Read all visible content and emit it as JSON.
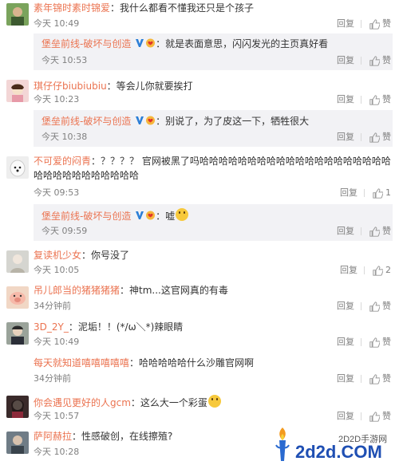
{
  "comments": [
    {
      "user": "素年锦时素时锦爱",
      "text": "：我什么都看不懂我还只是个孩子",
      "time": "今天 10:49",
      "reply": "回复",
      "like": "赞"
    },
    {
      "sub": true,
      "user": "堡垒前线-破坏与创造",
      "text": "：就是表面意思，闪闪发光的主页真好看",
      "time": "今天 10:53",
      "reply": "回复",
      "like": "赞"
    },
    {
      "user": "琪仔仔biubiubiu",
      "text": "：等会儿你就要挨打",
      "time": "今天 10:23",
      "reply": "回复",
      "like": "赞"
    },
    {
      "sub": true,
      "user": "堡垒前线-破坏与创造",
      "text": "：别说了，为了皮这一下，牺牲很大",
      "time": "今天 10:38",
      "reply": "回复",
      "like": "赞"
    },
    {
      "user": "不可爱的闷青",
      "text": "：？？？？ 官网被黑了吗哈哈哈哈哈哈哈哈哈哈哈哈哈哈哈哈哈哈哈哈哈哈哈哈哈哈哈哈哈哈哈",
      "time": "今天 09:53",
      "reply": "回复",
      "like": "1"
    },
    {
      "sub": true,
      "user": "堡垒前线-破坏与创造",
      "text": "：嘘",
      "time": "今天 09:59",
      "reply": "回复",
      "like": "赞"
    },
    {
      "user": "复读机少女",
      "text": "：你号没了",
      "time": "今天 10:05",
      "reply": "回复",
      "like": "2"
    },
    {
      "user": "吊儿郎当的猪猪猪猪",
      "text": "：神tm...这官网真的有毒",
      "time": "34分钟前",
      "reply": "回复",
      "like": "赞"
    },
    {
      "user": "3D_2Y_",
      "text": "：泥垢！！(*/ω＼*)辣眼睛",
      "time": "今天 10:49",
      "reply": "回复",
      "like": "赞"
    },
    {
      "user": "每天就知道嘻嘻嘻嘻嘻",
      "text": "：哈哈哈哈哈什么沙雕官网啊",
      "time": "34分钟前",
      "reply": "回复",
      "like": "赞"
    },
    {
      "user": "你会遇见更好的人gcm",
      "text": "：这么大一个彩蛋",
      "time": "今天 10:57",
      "reply": "回复",
      "like": "赞"
    },
    {
      "user": "萨阿赫拉",
      "text": "：性感破创，在线擦殖?",
      "time": "今天 10:28",
      "reply": "回复",
      "like": "赞"
    }
  ],
  "watermark": {
    "site": "2D2D手游网",
    "domain": "2d2d.COM"
  },
  "colors": {
    "username": "#eb7350",
    "meta": "#808080",
    "reply_bg": "#f2f2f5"
  }
}
